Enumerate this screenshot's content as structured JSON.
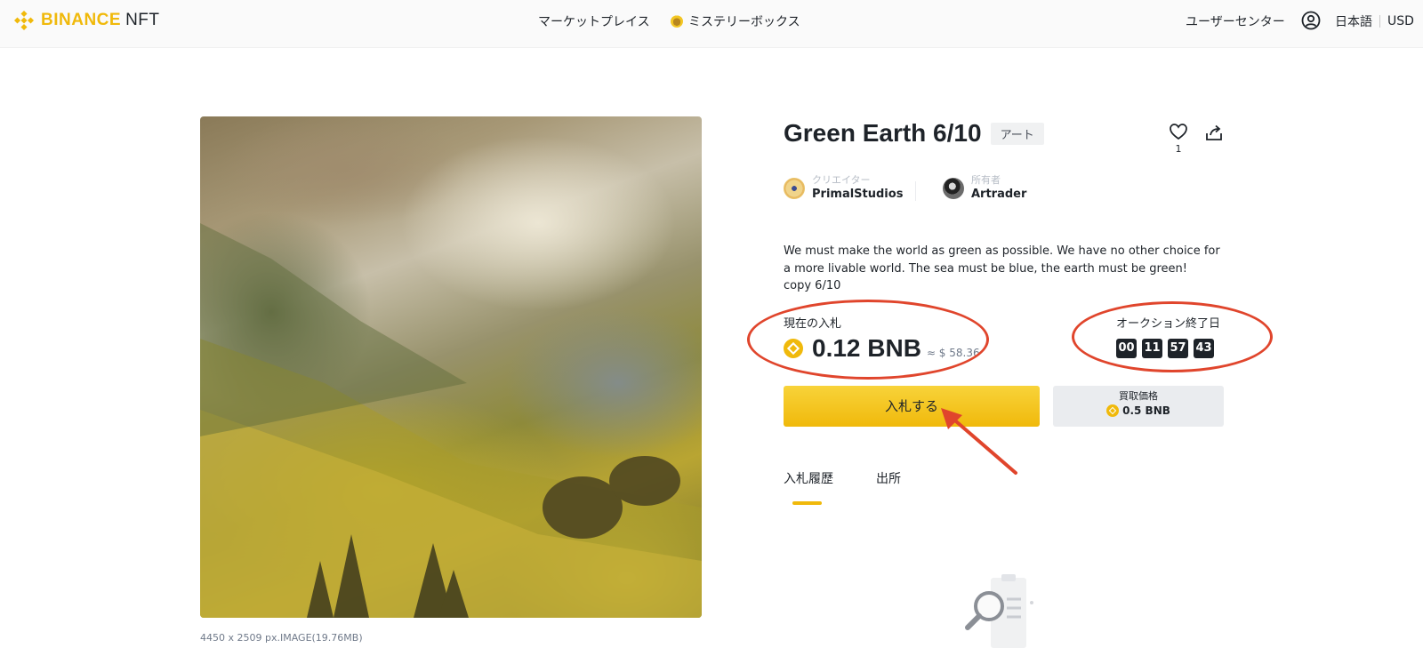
{
  "header": {
    "brand": "BINANCE",
    "brand_suffix": "NFT",
    "nav": [
      "マーケットプレイス",
      "ミステリーボックス"
    ],
    "user_center": "ユーザーセンター",
    "language": "日本語",
    "currency": "USD"
  },
  "artwork": {
    "meta": "4450 x 2509 px.IMAGE(19.76MB)"
  },
  "item": {
    "title": "Green Earth 6/10",
    "category": "アート",
    "likes": "1",
    "creator_role": "クリエイター",
    "creator_name": "PrimalStudios",
    "owner_role": "所有者",
    "owner_name": "Artrader",
    "description": "We must make the world as green as possible. We have no other choice for a more livable world. The sea must be blue, the earth must be green!",
    "copy": "copy 6/10"
  },
  "bid": {
    "label": "現在の入札",
    "value": "0.12 BNB",
    "usd": "≈ $ 58.36",
    "button": "入札する"
  },
  "auction": {
    "label": "オークション終了日",
    "timer": [
      "00",
      "11",
      "57",
      "43"
    ]
  },
  "buyout": {
    "label": "買取価格",
    "price": "0.5 BNB"
  },
  "tabs": [
    "入札履歴",
    "出所"
  ],
  "colors": {
    "brand": "#f0b90b",
    "annotation": "#e0452c",
    "text": "#1e2329"
  }
}
